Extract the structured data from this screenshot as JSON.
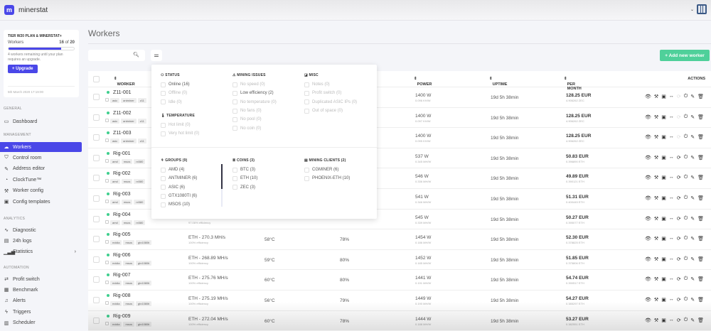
{
  "app": {
    "brand": "minerstat",
    "logo_letter": "m"
  },
  "plan": {
    "title": "TIER W20 PLAN & MINERSTAT+",
    "workers_label": "Workers",
    "used": 16,
    "of_label": "of",
    "total": 20,
    "usage_fraction": 0.8,
    "note": "4 workers remaining until your plan requires an upgrade.",
    "upgrade_label": "Upgrade",
    "date": "5th March 2020 17:19:00"
  },
  "sidebar": {
    "sections": [
      {
        "title": "GENERAL",
        "items": [
          {
            "label": "Dashboard",
            "icon": "monitor-icon"
          }
        ]
      },
      {
        "title": "MANAGEMENT",
        "items": [
          {
            "label": "Workers",
            "icon": "cloud-icon",
            "active": true
          },
          {
            "label": "Control room",
            "icon": "shield-icon"
          },
          {
            "label": "Address editor",
            "icon": "address-icon"
          },
          {
            "label": "ClockTune™",
            "icon": "gauge-icon"
          },
          {
            "label": "Worker config",
            "icon": "wrench-icon"
          },
          {
            "label": "Config templates",
            "icon": "template-icon"
          }
        ]
      },
      {
        "title": "ANALYTICS",
        "items": [
          {
            "label": "Diagnostic",
            "icon": "pulse-icon"
          },
          {
            "label": "24h logs",
            "icon": "log-icon"
          },
          {
            "label": "Statistics",
            "icon": "bars-icon",
            "chevron": true
          }
        ]
      },
      {
        "title": "AUTOMATION",
        "items": [
          {
            "label": "Profit switch",
            "icon": "switch-icon"
          },
          {
            "label": "Benchmark",
            "icon": "benchmark-icon"
          },
          {
            "label": "Alerts",
            "icon": "bell-icon"
          },
          {
            "label": "Triggers",
            "icon": "trigger-icon"
          },
          {
            "label": "Scheduler",
            "icon": "calendar-icon"
          }
        ]
      }
    ]
  },
  "page": {
    "title": "Workers",
    "search_placeholder": "",
    "add_worker_label": "+  Add new worker"
  },
  "table": {
    "headers": {
      "worker": "WORKER",
      "power": "POWER",
      "uptime": "UPTIME",
      "per_month": "PER MONTH",
      "actions": "ACTIONS"
    },
    "rows": [
      {
        "name": "Z11-001",
        "tags": [
          "asic",
          "antminer",
          "z11"
        ],
        "hashrate": null,
        "efficiency": null,
        "temp": null,
        "fan": null,
        "power": "1400 W",
        "power_eff": "0.096 KH/W",
        "uptime": "19d 5h 38min",
        "per_month": "128.25 EUR",
        "coin_amount": "4.906262 ZEC",
        "sync_enabled": false
      },
      {
        "name": "Z11-002",
        "tags": [
          "asic",
          "antminer",
          "z11"
        ],
        "hashrate": null,
        "efficiency": null,
        "temp": null,
        "fan": null,
        "power": "1400 W",
        "power_eff": "0.097 KH/W",
        "uptime": "19d 5h 38min",
        "per_month": "128.25 EUR",
        "coin_amount": "4.906262 ZEC",
        "sync_enabled": false
      },
      {
        "name": "Z11-003",
        "tags": [
          "asic",
          "antminer",
          "z11"
        ],
        "hashrate": null,
        "efficiency": null,
        "temp": null,
        "fan": null,
        "power": "1400 W",
        "power_eff": "0.095 KH/W",
        "uptime": "19d 5h 38min",
        "per_month": "128.25 EUR",
        "coin_amount": "4.906262 ZEC",
        "sync_enabled": false
      },
      {
        "name": "Rig-001",
        "tags": [
          "amd",
          "msos",
          "rx580"
        ],
        "hashrate": null,
        "efficiency": null,
        "temp": null,
        "fan": null,
        "power": "537 W",
        "power_eff": "0.345 MH/W",
        "uptime": "19d 5h 38min",
        "per_month": "50.83 EUR",
        "coin_amount": "0.396890 ETH",
        "sync_enabled": true
      },
      {
        "name": "Rig-002",
        "tags": [
          "amd",
          "msos",
          "rx580"
        ],
        "hashrate": null,
        "efficiency": null,
        "temp": null,
        "fan": null,
        "power": "546 W",
        "power_eff": "0.336 MH/W",
        "uptime": "19d 5h 38min",
        "per_month": "49.89 EUR",
        "coin_amount": "0.390121 ETH",
        "sync_enabled": true
      },
      {
        "name": "Rig-003",
        "tags": [
          "amd",
          "msos",
          "rx580"
        ],
        "hashrate": null,
        "efficiency": null,
        "temp": null,
        "fan": null,
        "power": "541 W",
        "power_eff": "0.346 MH/W",
        "uptime": "19d 5h 38min",
        "per_month": "51.31 EUR",
        "coin_amount": "0.400445 ETH",
        "sync_enabled": true
      },
      {
        "name": "Rig-004",
        "tags": [
          "amd",
          "msos",
          "rx580"
        ],
        "hashrate": null,
        "efficiency": "97.06% efficiency",
        "temp": null,
        "fan": null,
        "power": "545 W",
        "power_eff": "0.339 MH/W",
        "uptime": "19d 5h 38min",
        "per_month": "50.27 EUR",
        "coin_amount": "0.395077 ETH",
        "sync_enabled": true
      },
      {
        "name": "Rig-005",
        "tags": [
          "nvidia",
          "msos",
          "gtx1080ti"
        ],
        "hashrate": "ETH - 270.3 MH/s",
        "efficiency": "100% efficiency",
        "temp": "58°C",
        "fan": "78%",
        "power": "1454 W",
        "power_eff": "0.186 MH/W",
        "uptime": "19d 5h 38min",
        "per_month": "52.30 EUR",
        "coin_amount": "0.378825 ETH",
        "sync_enabled": true
      },
      {
        "name": "Rig-006",
        "tags": [
          "nvidia",
          "msos",
          "gtx1080ti"
        ],
        "hashrate": "ETH - 268.89 MH/s",
        "efficiency": "100% efficiency",
        "temp": "59°C",
        "fan": "80%",
        "power": "1452 W",
        "power_eff": "0.185 MH/W",
        "uptime": "19d 5h 38min",
        "per_month": "51.85 EUR",
        "coin_amount": "0.375806 ETH",
        "sync_enabled": true
      },
      {
        "name": "Rig-007",
        "tags": [
          "nvidia",
          "msos",
          "gtx1080ti"
        ],
        "hashrate": "ETH - 275.76 MH/s",
        "efficiency": "100% efficiency",
        "temp": "60°C",
        "fan": "80%",
        "power": "1441 W",
        "power_eff": "0.191 MH/W",
        "uptime": "19d 5h 38min",
        "per_month": "54.74 EUR",
        "coin_amount": "0.390517 ETH",
        "sync_enabled": true
      },
      {
        "name": "Rig-008",
        "tags": [
          "nvidia",
          "msos",
          "gtx1080ti"
        ],
        "hashrate": "ETH - 275.19 MH/s",
        "efficiency": "100% efficiency",
        "temp": "56°C",
        "fan": "79%",
        "power": "1449 W",
        "power_eff": "0.190 MH/W",
        "uptime": "19d 5h 38min",
        "per_month": "54.27 EUR",
        "coin_amount": "0.385297 ETH",
        "sync_enabled": true
      },
      {
        "name": "Rig-009",
        "tags": [
          "nvidia",
          "msos",
          "gtx1080ti"
        ],
        "hashrate": "ETH - 272.04 MH/s",
        "efficiency": "100% efficiency",
        "temp": "60°C",
        "fan": "78%",
        "power": "1444 W",
        "power_eff": "0.188 MH/W",
        "uptime": "19d 5h 38min",
        "per_month": "53.27 EUR",
        "coin_amount": "0.382551 ETH",
        "sync_enabled": true
      }
    ]
  },
  "filters": {
    "top": [
      {
        "title": "STATUS",
        "icon": "status-icon",
        "options": [
          {
            "label": "Online (16)",
            "active": true
          },
          {
            "label": "Offline (0)"
          },
          {
            "label": "Idle (0)"
          }
        ]
      },
      {
        "title": "MINING ISSUES",
        "icon": "warning-icon",
        "options": [
          {
            "label": "No speed (0)"
          },
          {
            "label": "Low efficiency (2)",
            "active": true
          },
          {
            "label": "No temperature (0)"
          },
          {
            "label": "No fans (0)"
          },
          {
            "label": "No pool (0)"
          },
          {
            "label": "No coin (0)"
          }
        ]
      },
      {
        "title": "MISC",
        "icon": "misc-icon",
        "options": [
          {
            "label": "Notes (0)"
          },
          {
            "label": "Profit switch (0)"
          },
          {
            "label": "Duplicated ASIC IPs (0)"
          },
          {
            "label": "Out of space (0)"
          }
        ]
      },
      {
        "title": "TEMPERATURE",
        "icon": "thermometer-icon",
        "options": [
          {
            "label": "Hot limit (0)"
          },
          {
            "label": "Very hot limit (0)"
          }
        ]
      }
    ],
    "bottom": [
      {
        "title": "GROUPS (9)",
        "icon": "groups-icon",
        "options": [
          {
            "label": "AMD (4)",
            "active": true
          },
          {
            "label": "ANTMINER (6)",
            "active": true
          },
          {
            "label": "ASIC (6)",
            "active": true
          },
          {
            "label": "GTX1080TI (6)",
            "active": true
          },
          {
            "label": "MSOS (10)",
            "active": true
          }
        ]
      },
      {
        "title": "COINS (3)",
        "icon": "coins-icon",
        "options": [
          {
            "label": "BTC (3)",
            "active": true
          },
          {
            "label": "ETH (10)",
            "active": true
          },
          {
            "label": "ZEC (3)",
            "active": true
          }
        ]
      },
      {
        "title": "MINING CLIENTS (2)",
        "icon": "client-icon",
        "options": [
          {
            "label": "CGMINER (6)",
            "active": true
          },
          {
            "label": "PHOENIX-ETH (10)",
            "active": true
          }
        ]
      }
    ]
  },
  "colors": {
    "accent": "#4a47e8",
    "success": "#4fd09a",
    "online": "#3ecf8e"
  }
}
